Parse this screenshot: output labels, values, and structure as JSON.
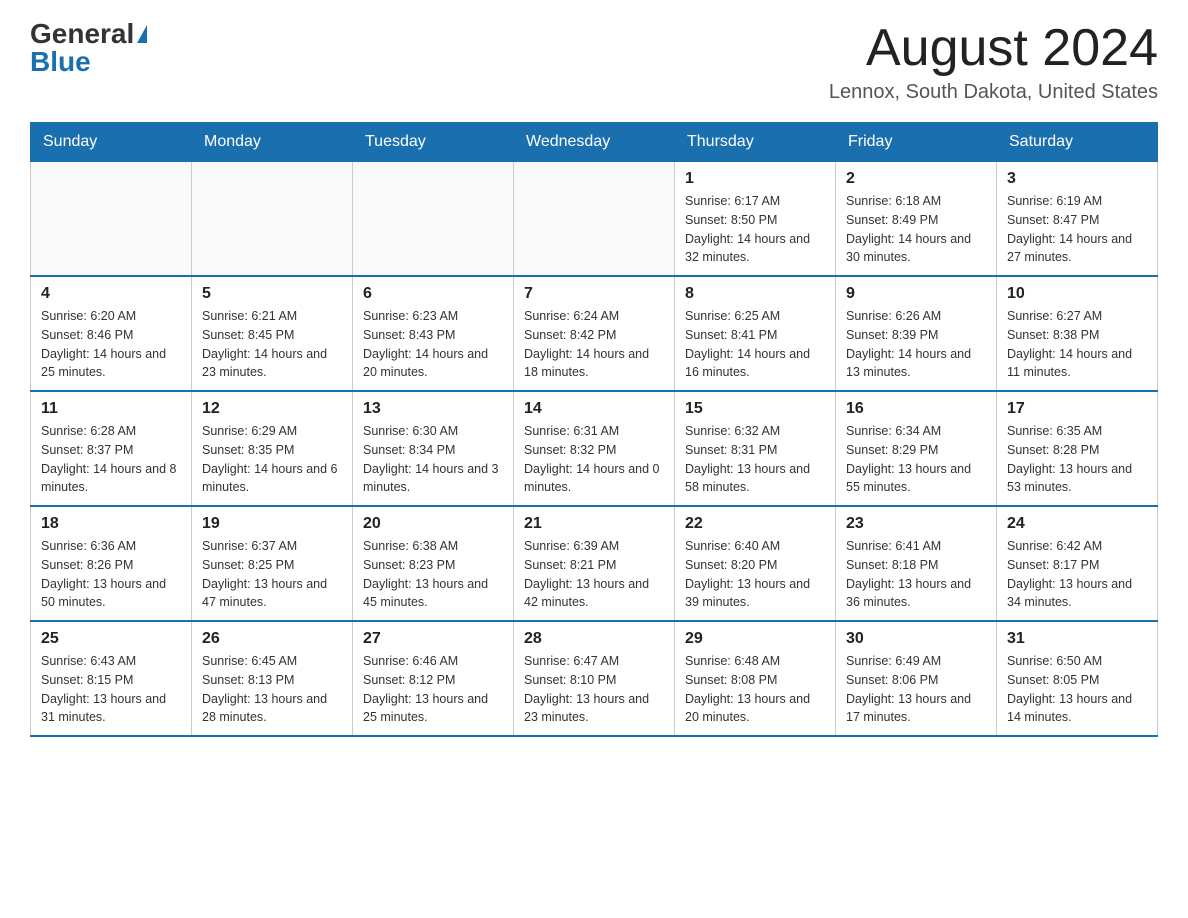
{
  "header": {
    "logo_general": "General",
    "logo_blue": "Blue",
    "title": "August 2024",
    "subtitle": "Lennox, South Dakota, United States"
  },
  "days_of_week": [
    "Sunday",
    "Monday",
    "Tuesday",
    "Wednesday",
    "Thursday",
    "Friday",
    "Saturday"
  ],
  "weeks": [
    [
      {
        "day": "",
        "info": ""
      },
      {
        "day": "",
        "info": ""
      },
      {
        "day": "",
        "info": ""
      },
      {
        "day": "",
        "info": ""
      },
      {
        "day": "1",
        "info": "Sunrise: 6:17 AM\nSunset: 8:50 PM\nDaylight: 14 hours and 32 minutes."
      },
      {
        "day": "2",
        "info": "Sunrise: 6:18 AM\nSunset: 8:49 PM\nDaylight: 14 hours and 30 minutes."
      },
      {
        "day": "3",
        "info": "Sunrise: 6:19 AM\nSunset: 8:47 PM\nDaylight: 14 hours and 27 minutes."
      }
    ],
    [
      {
        "day": "4",
        "info": "Sunrise: 6:20 AM\nSunset: 8:46 PM\nDaylight: 14 hours and 25 minutes."
      },
      {
        "day": "5",
        "info": "Sunrise: 6:21 AM\nSunset: 8:45 PM\nDaylight: 14 hours and 23 minutes."
      },
      {
        "day": "6",
        "info": "Sunrise: 6:23 AM\nSunset: 8:43 PM\nDaylight: 14 hours and 20 minutes."
      },
      {
        "day": "7",
        "info": "Sunrise: 6:24 AM\nSunset: 8:42 PM\nDaylight: 14 hours and 18 minutes."
      },
      {
        "day": "8",
        "info": "Sunrise: 6:25 AM\nSunset: 8:41 PM\nDaylight: 14 hours and 16 minutes."
      },
      {
        "day": "9",
        "info": "Sunrise: 6:26 AM\nSunset: 8:39 PM\nDaylight: 14 hours and 13 minutes."
      },
      {
        "day": "10",
        "info": "Sunrise: 6:27 AM\nSunset: 8:38 PM\nDaylight: 14 hours and 11 minutes."
      }
    ],
    [
      {
        "day": "11",
        "info": "Sunrise: 6:28 AM\nSunset: 8:37 PM\nDaylight: 14 hours and 8 minutes."
      },
      {
        "day": "12",
        "info": "Sunrise: 6:29 AM\nSunset: 8:35 PM\nDaylight: 14 hours and 6 minutes."
      },
      {
        "day": "13",
        "info": "Sunrise: 6:30 AM\nSunset: 8:34 PM\nDaylight: 14 hours and 3 minutes."
      },
      {
        "day": "14",
        "info": "Sunrise: 6:31 AM\nSunset: 8:32 PM\nDaylight: 14 hours and 0 minutes."
      },
      {
        "day": "15",
        "info": "Sunrise: 6:32 AM\nSunset: 8:31 PM\nDaylight: 13 hours and 58 minutes."
      },
      {
        "day": "16",
        "info": "Sunrise: 6:34 AM\nSunset: 8:29 PM\nDaylight: 13 hours and 55 minutes."
      },
      {
        "day": "17",
        "info": "Sunrise: 6:35 AM\nSunset: 8:28 PM\nDaylight: 13 hours and 53 minutes."
      }
    ],
    [
      {
        "day": "18",
        "info": "Sunrise: 6:36 AM\nSunset: 8:26 PM\nDaylight: 13 hours and 50 minutes."
      },
      {
        "day": "19",
        "info": "Sunrise: 6:37 AM\nSunset: 8:25 PM\nDaylight: 13 hours and 47 minutes."
      },
      {
        "day": "20",
        "info": "Sunrise: 6:38 AM\nSunset: 8:23 PM\nDaylight: 13 hours and 45 minutes."
      },
      {
        "day": "21",
        "info": "Sunrise: 6:39 AM\nSunset: 8:21 PM\nDaylight: 13 hours and 42 minutes."
      },
      {
        "day": "22",
        "info": "Sunrise: 6:40 AM\nSunset: 8:20 PM\nDaylight: 13 hours and 39 minutes."
      },
      {
        "day": "23",
        "info": "Sunrise: 6:41 AM\nSunset: 8:18 PM\nDaylight: 13 hours and 36 minutes."
      },
      {
        "day": "24",
        "info": "Sunrise: 6:42 AM\nSunset: 8:17 PM\nDaylight: 13 hours and 34 minutes."
      }
    ],
    [
      {
        "day": "25",
        "info": "Sunrise: 6:43 AM\nSunset: 8:15 PM\nDaylight: 13 hours and 31 minutes."
      },
      {
        "day": "26",
        "info": "Sunrise: 6:45 AM\nSunset: 8:13 PM\nDaylight: 13 hours and 28 minutes."
      },
      {
        "day": "27",
        "info": "Sunrise: 6:46 AM\nSunset: 8:12 PM\nDaylight: 13 hours and 25 minutes."
      },
      {
        "day": "28",
        "info": "Sunrise: 6:47 AM\nSunset: 8:10 PM\nDaylight: 13 hours and 23 minutes."
      },
      {
        "day": "29",
        "info": "Sunrise: 6:48 AM\nSunset: 8:08 PM\nDaylight: 13 hours and 20 minutes."
      },
      {
        "day": "30",
        "info": "Sunrise: 6:49 AM\nSunset: 8:06 PM\nDaylight: 13 hours and 17 minutes."
      },
      {
        "day": "31",
        "info": "Sunrise: 6:50 AM\nSunset: 8:05 PM\nDaylight: 13 hours and 14 minutes."
      }
    ]
  ]
}
